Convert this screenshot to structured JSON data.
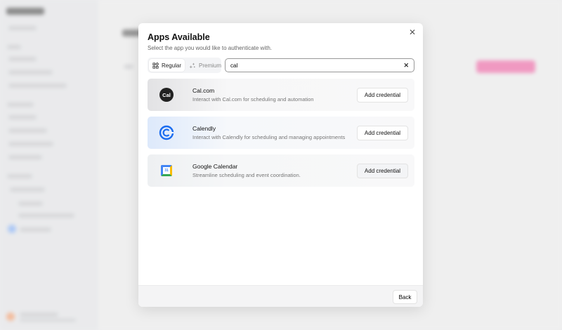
{
  "modal": {
    "title": "Apps Available",
    "subtitle": "Select the app you would like to authenticate with.",
    "tabs": [
      {
        "label": "Regular",
        "active": true
      },
      {
        "label": "Premium",
        "active": false
      }
    ],
    "search": {
      "value": "cal"
    },
    "apps": [
      {
        "name": "Cal.com",
        "description": "Interact with Cal.com for scheduling and automation",
        "button": "Add credential",
        "logo_text": "Cal"
      },
      {
        "name": "Calendly",
        "description": "Interact with Calendly for scheduling and managing appointments",
        "button": "Add credential"
      },
      {
        "name": "Google Calendar",
        "description": "Streamline scheduling and event coordination.",
        "button": "Add credential",
        "logo_text": "31"
      }
    ],
    "back_label": "Back"
  },
  "colors": {
    "accent_pink": "#f06aa8",
    "calendly_blue": "#1a6cf0"
  }
}
